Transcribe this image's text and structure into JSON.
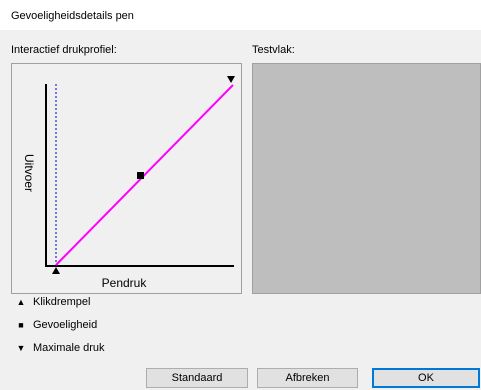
{
  "window": {
    "title": "Gevoeligheidsdetails pen"
  },
  "labels": {
    "interactive": "Interactief drukprofiel:",
    "test_area": "Testvlak:"
  },
  "curve": {
    "ylabel": "Uitvoer",
    "xlabel": "Pendruk"
  },
  "legend": [
    {
      "symbol": "▲",
      "label": "Klikdrempel"
    },
    {
      "symbol": "■",
      "label": "Gevoeligheid"
    },
    {
      "symbol": "▼",
      "label": "Maximale druk"
    }
  ],
  "buttons": {
    "default": "Standaard",
    "cancel": "Afbreken",
    "ok": "OK"
  },
  "colors": {
    "curve": "#ff00ff",
    "threshold_line": "#0000c0",
    "test_area": "#bebebe"
  }
}
